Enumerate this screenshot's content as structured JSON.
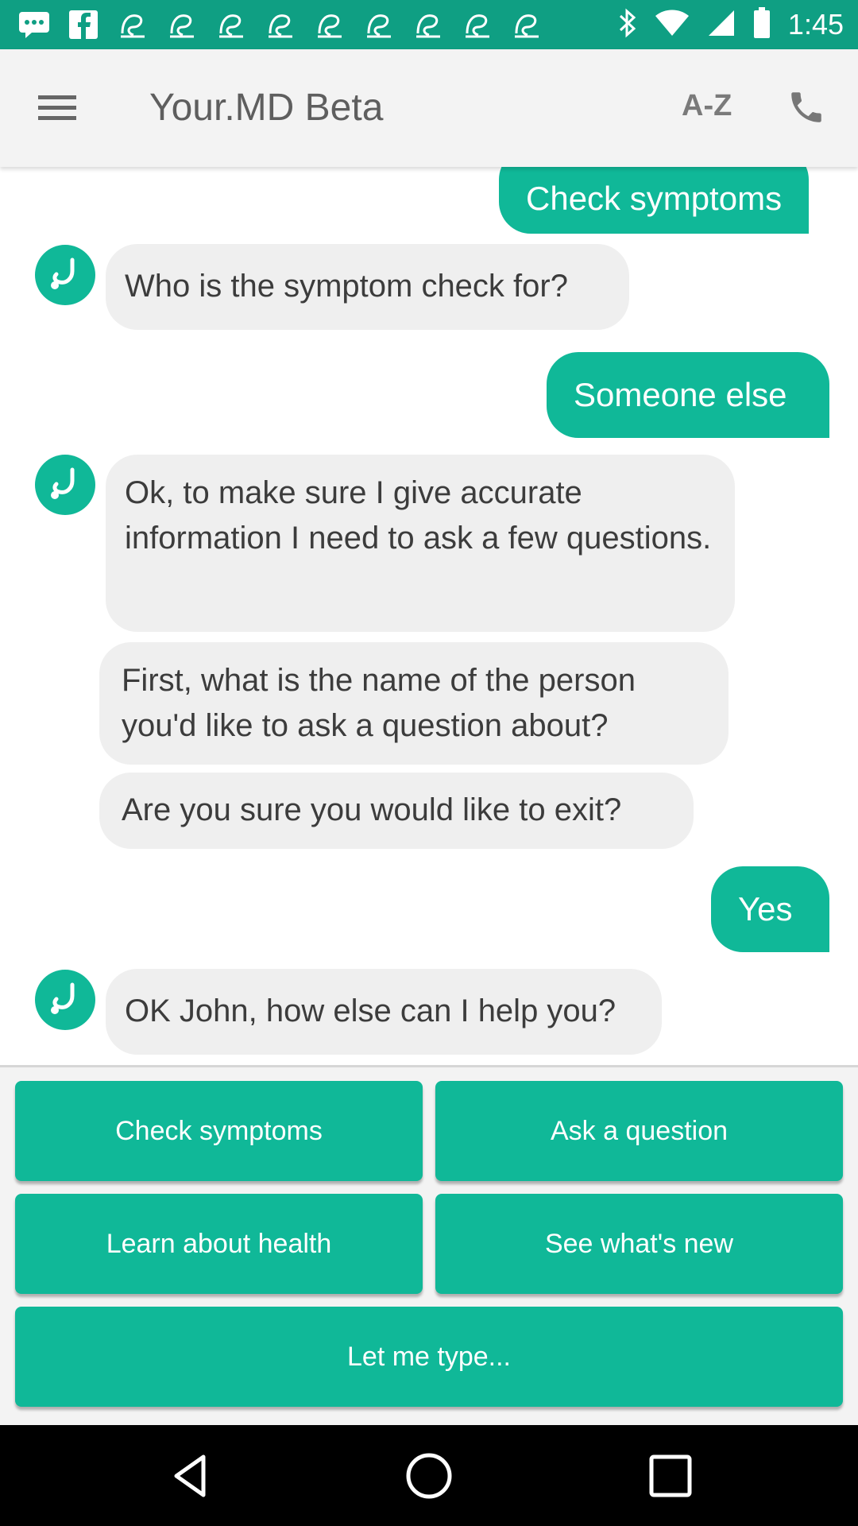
{
  "status_bar": {
    "time": "1:45",
    "notification_icons": [
      "message-icon",
      "facebook-icon",
      "app-icon",
      "app-icon",
      "app-icon",
      "app-icon",
      "app-icon",
      "app-icon",
      "app-icon",
      "app-icon",
      "app-icon"
    ],
    "right_icons": [
      "bluetooth-icon",
      "wifi-icon",
      "signal-icon",
      "battery-icon"
    ]
  },
  "app_bar": {
    "title": "Your.MD Beta",
    "az_label": "A-Z"
  },
  "chat": {
    "messages": [
      {
        "from": "user",
        "text": "Check symptoms"
      },
      {
        "from": "bot",
        "text": "Who is the symptom check for?"
      },
      {
        "from": "user",
        "text": "Someone else"
      },
      {
        "from": "bot",
        "text": "Ok, to make sure I give accurate information I need to ask a few questions."
      },
      {
        "from": "bot",
        "text": "First, what is the name of the person you'd like to ask a question about?"
      },
      {
        "from": "bot",
        "text": "Are you sure you would like to exit?"
      },
      {
        "from": "user",
        "text": "Yes"
      },
      {
        "from": "bot",
        "text": "OK John, how else can I help you?"
      }
    ]
  },
  "quick_replies": {
    "check_symptoms": "Check symptoms",
    "ask_question": "Ask a question",
    "learn_health": "Learn about health",
    "whats_new": "See what's new",
    "let_me_type": "Let me type..."
  },
  "colors": {
    "status_bar": "#0f9f83",
    "accent": "#10b898",
    "bot_bubble": "#efefef"
  }
}
